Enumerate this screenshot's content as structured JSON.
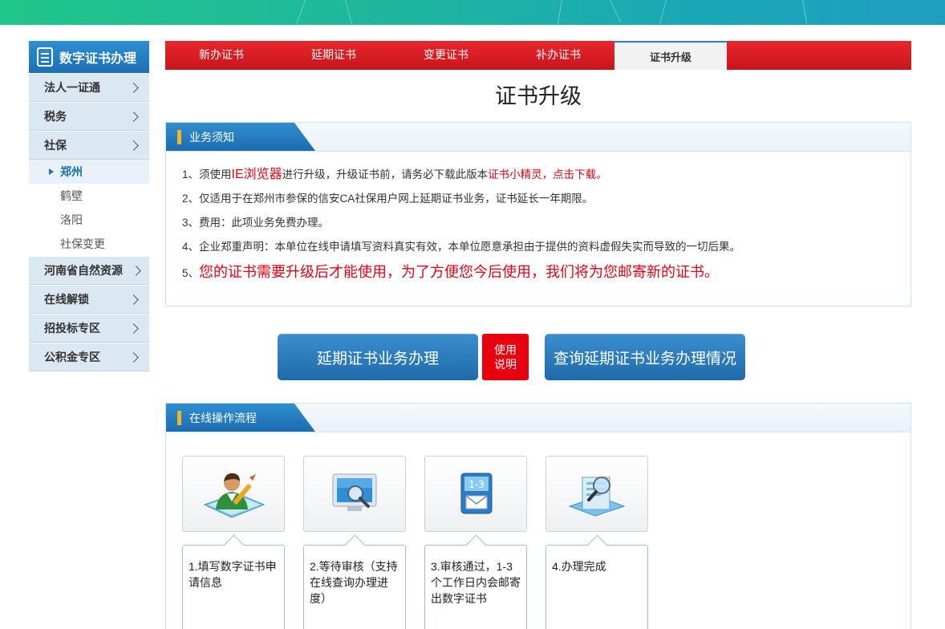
{
  "sidebar": {
    "title": "数字证书办理",
    "items": [
      {
        "label": "法人一证通"
      },
      {
        "label": "税务"
      },
      {
        "label": "社保"
      }
    ],
    "sub_items": [
      {
        "label": "郑州"
      },
      {
        "label": "鹤壁"
      },
      {
        "label": "洛阳"
      },
      {
        "label": "社保变更"
      }
    ],
    "items_after": [
      {
        "label": "河南省自然资源"
      },
      {
        "label": "在线解锁"
      },
      {
        "label": "招投标专区"
      },
      {
        "label": "公积金专区"
      }
    ]
  },
  "tabs": [
    {
      "label": "新办证书"
    },
    {
      "label": "延期证书"
    },
    {
      "label": "变更证书"
    },
    {
      "label": "补办证书"
    },
    {
      "label": "证书升级"
    }
  ],
  "page_title": "证书升级",
  "notice": {
    "title": "业务须知",
    "line1": {
      "prefix": "1、须使用",
      "browser": "IE浏览器",
      "middle": "进行升级，升级证书前，请务必下载此版本",
      "link": "证书小精灵，点击下载。"
    },
    "line2": "2、仅适用于在郑州市参保的信安CA社保用户网上延期证书业务，证书延长一年期限。",
    "line3": "3、费用：此项业务免费办理。",
    "line4": "4、企业郑重声明：本单位在线申请填写资料真实有效，本单位愿意承担由于提供的资料虚假失实而导致的一切后果。",
    "line5": {
      "num": "5、",
      "text": "您的证书需要升级后才能使用，为了方便您今后使用，我们将为您邮寄新的证书。"
    }
  },
  "actions": {
    "renew": "延期证书业务办理",
    "help_line1": "使用",
    "help_line2": "说明",
    "query": "查询延期证书业务办理情况"
  },
  "process": {
    "title": "在线操作流程",
    "steps": [
      {
        "text": "1.填写数字证书申请信息",
        "icon": "user-edit-icon"
      },
      {
        "text": "2.等待审核（支持在线查询办理进度）",
        "icon": "monitor-search-icon"
      },
      {
        "text": "3.审核通过，1-3个工作日内会邮寄出数字证书",
        "icon": "calendar-mail-icon"
      },
      {
        "text": "4.办理完成",
        "icon": "document-magnifier-icon"
      }
    ]
  },
  "colors": {
    "brand_red": "#e60012",
    "brand_blue": "#1f6aab",
    "banner_green": "#21c68a"
  }
}
